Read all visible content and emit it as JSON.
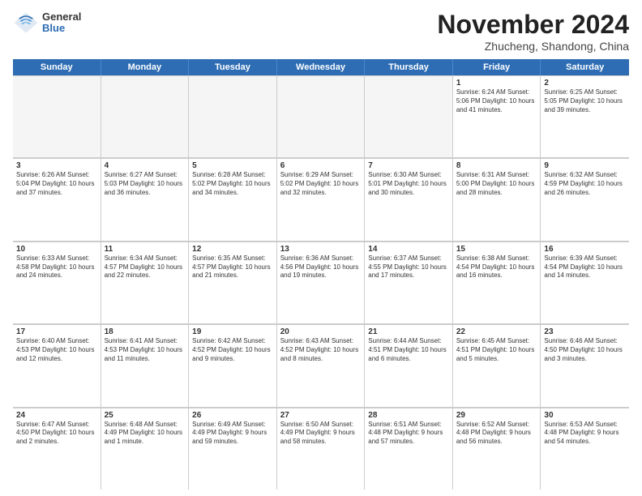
{
  "header": {
    "logo": {
      "general": "General",
      "blue": "Blue"
    },
    "title": "November 2024",
    "location": "Zhucheng, Shandong, China"
  },
  "calendar": {
    "weekdays": [
      "Sunday",
      "Monday",
      "Tuesday",
      "Wednesday",
      "Thursday",
      "Friday",
      "Saturday"
    ],
    "rows": [
      [
        {
          "day": "",
          "info": "",
          "empty": true
        },
        {
          "day": "",
          "info": "",
          "empty": true
        },
        {
          "day": "",
          "info": "",
          "empty": true
        },
        {
          "day": "",
          "info": "",
          "empty": true
        },
        {
          "day": "",
          "info": "",
          "empty": true
        },
        {
          "day": "1",
          "info": "Sunrise: 6:24 AM\nSunset: 5:06 PM\nDaylight: 10 hours\nand 41 minutes.",
          "empty": false
        },
        {
          "day": "2",
          "info": "Sunrise: 6:25 AM\nSunset: 5:05 PM\nDaylight: 10 hours\nand 39 minutes.",
          "empty": false
        }
      ],
      [
        {
          "day": "3",
          "info": "Sunrise: 6:26 AM\nSunset: 5:04 PM\nDaylight: 10 hours\nand 37 minutes.",
          "empty": false
        },
        {
          "day": "4",
          "info": "Sunrise: 6:27 AM\nSunset: 5:03 PM\nDaylight: 10 hours\nand 36 minutes.",
          "empty": false
        },
        {
          "day": "5",
          "info": "Sunrise: 6:28 AM\nSunset: 5:02 PM\nDaylight: 10 hours\nand 34 minutes.",
          "empty": false
        },
        {
          "day": "6",
          "info": "Sunrise: 6:29 AM\nSunset: 5:02 PM\nDaylight: 10 hours\nand 32 minutes.",
          "empty": false
        },
        {
          "day": "7",
          "info": "Sunrise: 6:30 AM\nSunset: 5:01 PM\nDaylight: 10 hours\nand 30 minutes.",
          "empty": false
        },
        {
          "day": "8",
          "info": "Sunrise: 6:31 AM\nSunset: 5:00 PM\nDaylight: 10 hours\nand 28 minutes.",
          "empty": false
        },
        {
          "day": "9",
          "info": "Sunrise: 6:32 AM\nSunset: 4:59 PM\nDaylight: 10 hours\nand 26 minutes.",
          "empty": false
        }
      ],
      [
        {
          "day": "10",
          "info": "Sunrise: 6:33 AM\nSunset: 4:58 PM\nDaylight: 10 hours\nand 24 minutes.",
          "empty": false
        },
        {
          "day": "11",
          "info": "Sunrise: 6:34 AM\nSunset: 4:57 PM\nDaylight: 10 hours\nand 22 minutes.",
          "empty": false
        },
        {
          "day": "12",
          "info": "Sunrise: 6:35 AM\nSunset: 4:57 PM\nDaylight: 10 hours\nand 21 minutes.",
          "empty": false
        },
        {
          "day": "13",
          "info": "Sunrise: 6:36 AM\nSunset: 4:56 PM\nDaylight: 10 hours\nand 19 minutes.",
          "empty": false
        },
        {
          "day": "14",
          "info": "Sunrise: 6:37 AM\nSunset: 4:55 PM\nDaylight: 10 hours\nand 17 minutes.",
          "empty": false
        },
        {
          "day": "15",
          "info": "Sunrise: 6:38 AM\nSunset: 4:54 PM\nDaylight: 10 hours\nand 16 minutes.",
          "empty": false
        },
        {
          "day": "16",
          "info": "Sunrise: 6:39 AM\nSunset: 4:54 PM\nDaylight: 10 hours\nand 14 minutes.",
          "empty": false
        }
      ],
      [
        {
          "day": "17",
          "info": "Sunrise: 6:40 AM\nSunset: 4:53 PM\nDaylight: 10 hours\nand 12 minutes.",
          "empty": false
        },
        {
          "day": "18",
          "info": "Sunrise: 6:41 AM\nSunset: 4:53 PM\nDaylight: 10 hours\nand 11 minutes.",
          "empty": false
        },
        {
          "day": "19",
          "info": "Sunrise: 6:42 AM\nSunset: 4:52 PM\nDaylight: 10 hours\nand 9 minutes.",
          "empty": false
        },
        {
          "day": "20",
          "info": "Sunrise: 6:43 AM\nSunset: 4:52 PM\nDaylight: 10 hours\nand 8 minutes.",
          "empty": false
        },
        {
          "day": "21",
          "info": "Sunrise: 6:44 AM\nSunset: 4:51 PM\nDaylight: 10 hours\nand 6 minutes.",
          "empty": false
        },
        {
          "day": "22",
          "info": "Sunrise: 6:45 AM\nSunset: 4:51 PM\nDaylight: 10 hours\nand 5 minutes.",
          "empty": false
        },
        {
          "day": "23",
          "info": "Sunrise: 6:46 AM\nSunset: 4:50 PM\nDaylight: 10 hours\nand 3 minutes.",
          "empty": false
        }
      ],
      [
        {
          "day": "24",
          "info": "Sunrise: 6:47 AM\nSunset: 4:50 PM\nDaylight: 10 hours\nand 2 minutes.",
          "empty": false
        },
        {
          "day": "25",
          "info": "Sunrise: 6:48 AM\nSunset: 4:49 PM\nDaylight: 10 hours\nand 1 minute.",
          "empty": false
        },
        {
          "day": "26",
          "info": "Sunrise: 6:49 AM\nSunset: 4:49 PM\nDaylight: 9 hours\nand 59 minutes.",
          "empty": false
        },
        {
          "day": "27",
          "info": "Sunrise: 6:50 AM\nSunset: 4:49 PM\nDaylight: 9 hours\nand 58 minutes.",
          "empty": false
        },
        {
          "day": "28",
          "info": "Sunrise: 6:51 AM\nSunset: 4:48 PM\nDaylight: 9 hours\nand 57 minutes.",
          "empty": false
        },
        {
          "day": "29",
          "info": "Sunrise: 6:52 AM\nSunset: 4:48 PM\nDaylight: 9 hours\nand 56 minutes.",
          "empty": false
        },
        {
          "day": "30",
          "info": "Sunrise: 6:53 AM\nSunset: 4:48 PM\nDaylight: 9 hours\nand 54 minutes.",
          "empty": false
        }
      ]
    ]
  }
}
